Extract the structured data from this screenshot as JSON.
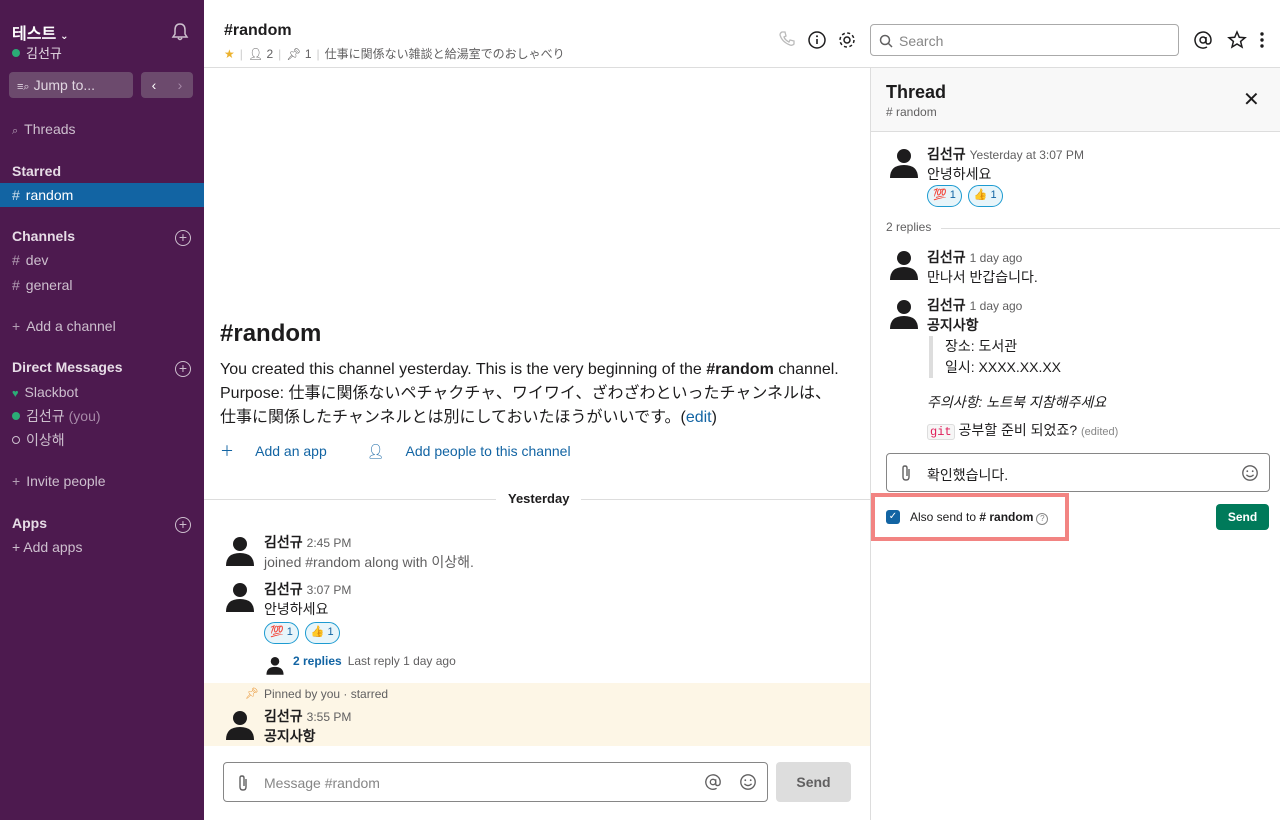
{
  "workspace": {
    "name": "테스트",
    "user": "김선규"
  },
  "sidebar": {
    "jump_label": "Jump to...",
    "threads_label": "Threads",
    "starred_header": "Starred",
    "starred": [
      {
        "label": "random",
        "active": true
      }
    ],
    "channels_header": "Channels",
    "channels": [
      {
        "label": "dev"
      },
      {
        "label": "general"
      }
    ],
    "add_channel": "Add a channel",
    "dm_header": "Direct Messages",
    "dms": [
      {
        "label": "Slackbot",
        "status": "heart"
      },
      {
        "label": "김선규",
        "suffix": "(you)",
        "status": "online"
      },
      {
        "label": "이상해",
        "status": "away"
      }
    ],
    "invite": "Invite people",
    "apps_header": "Apps",
    "add_apps": "+ Add apps"
  },
  "channel": {
    "title": "#random",
    "members": "2",
    "pins": "1",
    "topic": "仕事に関係ない雑談と給湯室でのおしゃべり"
  },
  "search": {
    "placeholder": "Search"
  },
  "intro": {
    "title": "#random",
    "text_1": "You created this channel yesterday. This is the very beginning of the ",
    "text_channel": "#random",
    "text_2": " channel. Purpose: 仕事に関係ないペチャクチャ、ワイワイ、ざわざわといったチャンネルは、仕事に関係したチャンネルとは別にしておいたほうがいいです。(",
    "edit": "edit",
    "text_3": ")",
    "add_app": "Add an app",
    "add_people": "Add people to this channel"
  },
  "divider_label": "Yesterday",
  "messages": [
    {
      "name": "김선규",
      "time": "2:45 PM",
      "text": "joined #random along with 이상해."
    },
    {
      "name": "김선규",
      "time": "3:07 PM",
      "text": "안녕하세요",
      "reactions": [
        {
          "emoji": "💯",
          "count": "1"
        },
        {
          "emoji": "👍",
          "count": "1"
        }
      ],
      "replies": "2 replies",
      "last_reply": "Last reply 1 day ago"
    },
    {
      "name": "김선규",
      "time": "3:55 PM",
      "text": "공지사항",
      "pinned_label": "Pinned by you · starred"
    }
  ],
  "composer": {
    "placeholder": "Message #random",
    "send": "Send"
  },
  "thread": {
    "title": "Thread",
    "channel": "# random",
    "parent": {
      "name": "김선규",
      "time": "Yesterday at 3:07 PM",
      "text": "안녕하세요",
      "reactions": [
        {
          "emoji": "💯",
          "count": "1"
        },
        {
          "emoji": "👍",
          "count": "1"
        }
      ]
    },
    "reply_count": "2 replies",
    "replies": [
      {
        "name": "김선규",
        "time": "1 day ago",
        "text": "만나서 반갑습니다."
      },
      {
        "name": "김선규",
        "time": "1 day ago",
        "title": "공지사항",
        "quote": [
          "장소: 도서관",
          "일시: XXXX.XX.XX"
        ],
        "note_label": "주의사항",
        "note_text": ": 노트북 지참해주세요",
        "code": "git",
        "code_text": " 공부할 준비 되었죠?",
        "edited": "(edited)"
      }
    ],
    "input_value": "확인했습니다.",
    "also_send_label": "Also send to ",
    "also_send_channel": "# random",
    "send": "Send"
  },
  "colors": {
    "sidebar": "#4d1a4f",
    "active": "#1264a3",
    "send": "#007a5a",
    "highlight": "#f28482"
  }
}
